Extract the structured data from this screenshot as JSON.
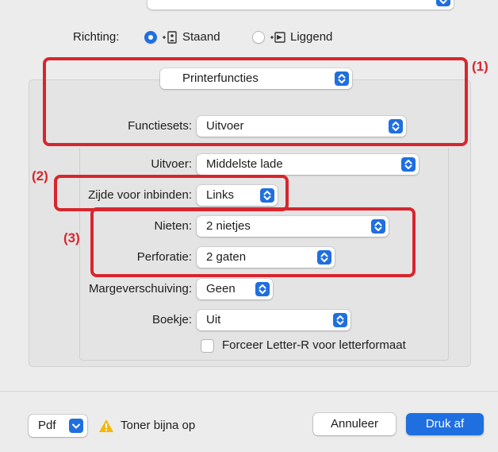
{
  "orientation": {
    "label": "Richting:",
    "options": [
      {
        "label": "Staand",
        "selected": true
      },
      {
        "label": "Liggend",
        "selected": false
      }
    ]
  },
  "panel": {
    "section_popup": "Printerfuncties",
    "feature_sets": {
      "label": "Functiesets:",
      "value": "Uitvoer"
    },
    "output": {
      "label": "Uitvoer:",
      "value": "Middelste lade"
    },
    "binding_edge": {
      "label": "Zijde voor inbinden:",
      "value": "Links"
    },
    "staple": {
      "label": "Nieten:",
      "value": "2 nietjes"
    },
    "punch": {
      "label": "Perforatie:",
      "value": "2 gaten"
    },
    "margin_shift": {
      "label": "Margeverschuiving:",
      "value": "Geen"
    },
    "booklet": {
      "label": "Boekje:",
      "value": "Uit"
    },
    "force_letter": {
      "label": "Forceer Letter-R voor letterformaat",
      "checked": false
    }
  },
  "callouts": {
    "c1": "(1)",
    "c2": "(2)",
    "c3": "(3)"
  },
  "footer": {
    "pdf_label": "Pdf",
    "warning_text": "Toner bijna op",
    "cancel_label": "Annuleer",
    "print_label": "Druk af"
  },
  "colors": {
    "accent": "#1f6fe0",
    "callout": "#d7262e",
    "warning": "#f5b800"
  }
}
